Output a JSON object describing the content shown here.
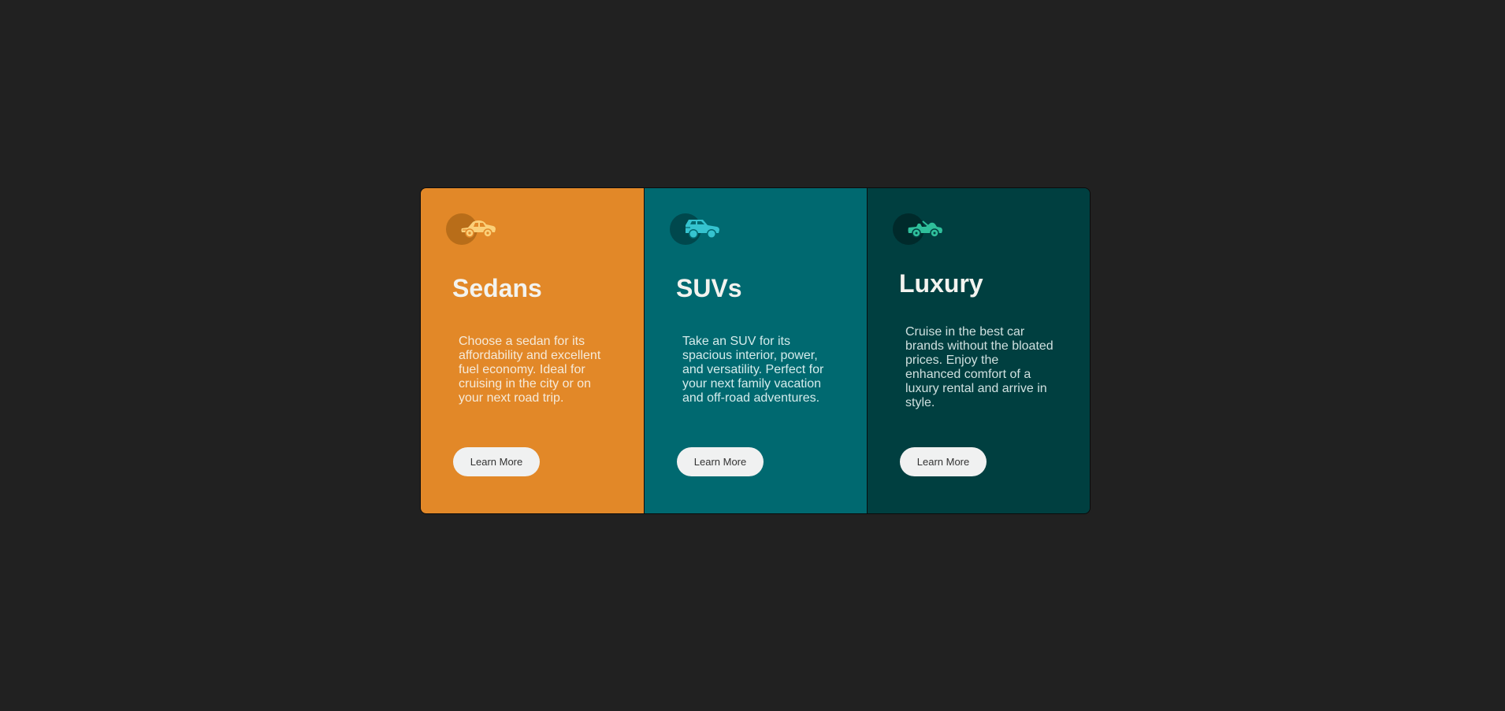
{
  "cards": [
    {
      "icon": "sedan-car-icon",
      "title": "Sedans",
      "description": "Choose a sedan for its affordability and excellent fuel economy. Ideal for cruising in the city or on your next road trip.",
      "button_label": "Learn More",
      "background": "#e28828",
      "icon_color": "#fbd079"
    },
    {
      "icon": "suv-car-icon",
      "title": "SUVs",
      "description": "Take an SUV for its spacious interior, power, and versatility. Perfect for your next family vacation and off-road adventures.",
      "button_label": "Learn More",
      "background": "#006970",
      "icon_color": "#35c3cf"
    },
    {
      "icon": "luxury-car-icon",
      "title": "Luxury",
      "description": "Cruise in the best car brands without the bloated prices. Enjoy the enhanced comfort of a luxury rental and arrive in style.",
      "button_label": "Learn More",
      "background": "#003f40",
      "icon_color": "#2fbf9b"
    }
  ],
  "page_background": "#212121"
}
